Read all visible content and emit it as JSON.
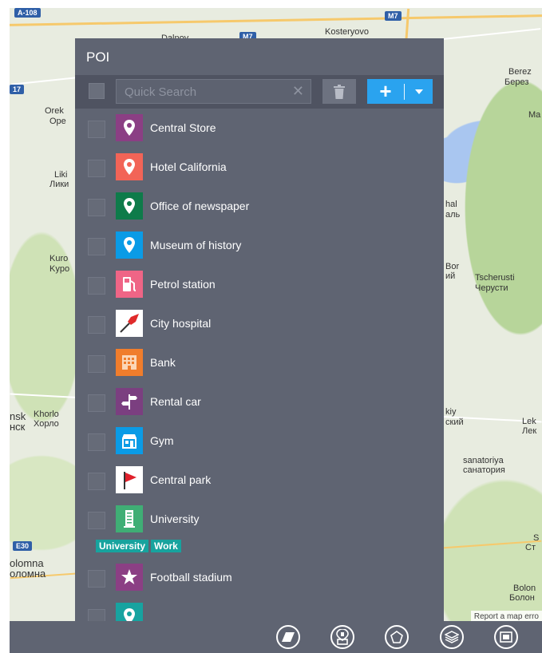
{
  "map": {
    "labels": [
      "A-108",
      "M7",
      "Kosteryovo",
      "Dalnov",
      "Berez",
      "Берез",
      "Ma",
      "17",
      "Orek",
      "Ope",
      "Liki",
      "Лики",
      "Kuro",
      "Kypo",
      "hal",
      "аль",
      "Bor",
      "ий",
      "Tscherusti",
      "Черусти",
      "nsk",
      "нск",
      "Khorlo",
      "Хорло",
      "kiy",
      "ский",
      "Lek",
      "Лек",
      "sanatoriya",
      "санатория",
      "E30",
      "olomna",
      "оломна",
      "S",
      "Ст",
      "Bolon",
      "Болон"
    ],
    "report_link": "Report a map erro"
  },
  "poi": {
    "title": "POI",
    "search": {
      "placeholder": "Quick Search",
      "value": ""
    },
    "items": [
      {
        "label": "Central Store",
        "icon": "map-pin-icon",
        "color": "#8b3f84"
      },
      {
        "label": "Hotel California",
        "icon": "map-pin-icon",
        "color": "#f26457"
      },
      {
        "label": "Office of newspaper",
        "icon": "map-pin-icon",
        "color": "#0e7b4a"
      },
      {
        "label": "Museum of history",
        "icon": "map-pin-icon",
        "color": "#0a9be6"
      },
      {
        "label": "Petrol station",
        "icon": "fuel-pump-icon",
        "color": "#ef6586"
      },
      {
        "label": "City hospital",
        "icon": "red-pushpin-icon",
        "color": "#ffffff"
      },
      {
        "label": "Bank",
        "icon": "bank-building-icon",
        "color": "#f07d2c"
      },
      {
        "label": "Rental car",
        "icon": "signpost-icon",
        "color": "#7b3f80"
      },
      {
        "label": "Gym",
        "icon": "storefront-icon",
        "color": "#0a9be6"
      },
      {
        "label": "Central park",
        "icon": "red-flag-icon",
        "color": "#ffffff"
      },
      {
        "label": "University",
        "icon": "tower-building-icon",
        "color": "#3fae75",
        "tags": [
          "University",
          "Work"
        ]
      },
      {
        "label": "Football stadium",
        "icon": "star-icon",
        "color": "#8b3f84"
      },
      {
        "label": "",
        "icon": "map-pin-icon",
        "color": "#17a3a0"
      }
    ]
  },
  "bottom_tools": [
    "eraser-icon",
    "poi-building-icon",
    "polygon-icon",
    "layers-icon",
    "window-icon"
  ]
}
